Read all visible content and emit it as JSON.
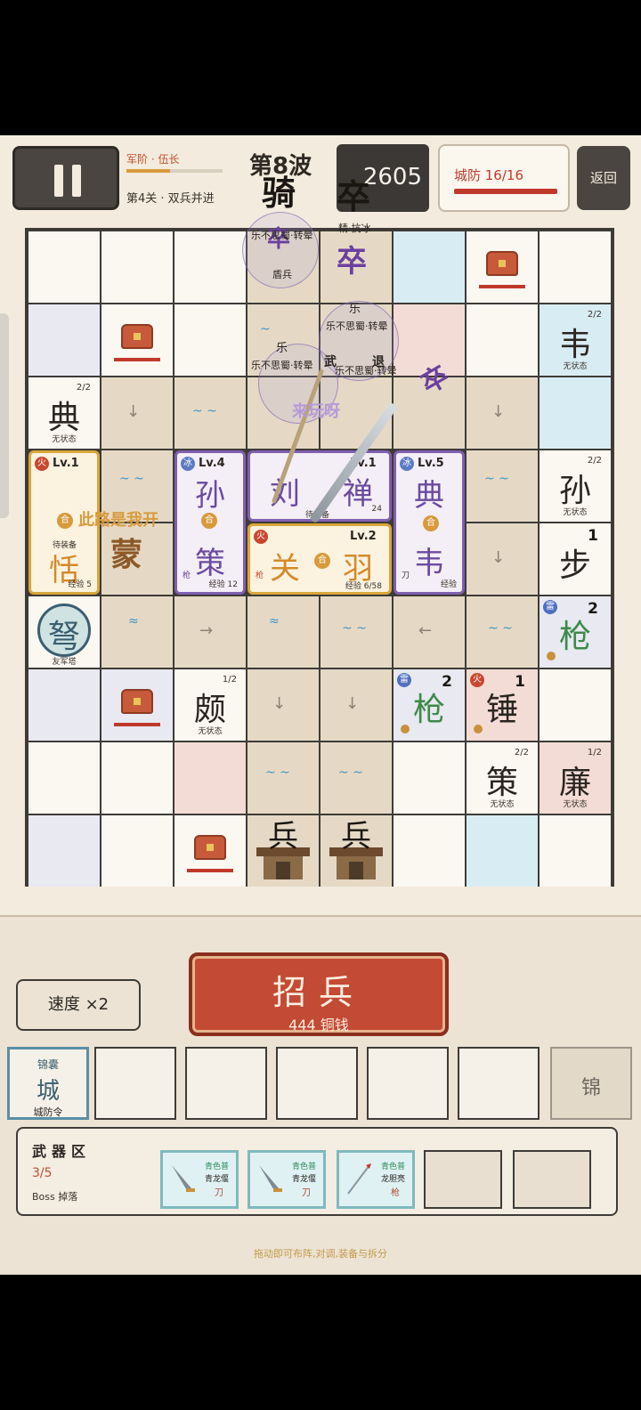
{
  "header": {
    "rank": "军阶 · 伍长",
    "rank_progress": 0.45,
    "level_name": "第4关 · 双兵并进",
    "wave": "第8波",
    "score": "2605",
    "city_defense": "城防 16/16",
    "return_label": "返回"
  },
  "board": {
    "enemies": [
      "骑",
      "卒",
      "卒",
      "卒",
      "卒"
    ],
    "status_texts": [
      "乐不思蜀·转晕",
      "乐不思蜀·转晕",
      "乐不思蜀·转晕",
      "乐不思蜀·转晕",
      "精·抗冰",
      "盾兵",
      "乐",
      "乐",
      "武",
      "退"
    ],
    "speech_1": "此路是我开",
    "speech_2": "来玩呀",
    "merge_symbol": "合",
    "tower_glyph": "蒙",
    "crossbow": {
      "glyph": "弩",
      "label": "友军塔"
    },
    "heroes": [
      {
        "element": "火",
        "level": "Lv.1",
        "name": "恬",
        "equip": "待装备",
        "xp": "经验 5"
      },
      {
        "element": "冰",
        "level": "Lv.4",
        "name_top": "孙",
        "name_bottom": "策",
        "weapon": "枪",
        "xp": "经验 12"
      },
      {
        "element": "",
        "level": "Lv.1",
        "name_left": "刘",
        "name_right": "禅",
        "equip": "待装备",
        "xp": "24"
      },
      {
        "element": "火",
        "level": "Lv.2",
        "name_left": "关",
        "name_right": "羽",
        "weapon": "枪",
        "xp": "经验 6/58"
      },
      {
        "element": "冰",
        "level": "Lv.5",
        "name_top": "典",
        "name_bottom": "韦",
        "weapon": "刀",
        "xp": "经验"
      }
    ],
    "units": [
      {
        "glyph": "韦",
        "count": "2/2",
        "status": "无状态"
      },
      {
        "glyph": "典",
        "count": "2/2",
        "status": "无状态"
      },
      {
        "glyph": "孙",
        "count": "2/2",
        "status": "无状态"
      },
      {
        "glyph": "步",
        "count": "1"
      },
      {
        "glyph": "枪",
        "count": "2",
        "element": "雷"
      },
      {
        "glyph": "颇",
        "count": "1/2",
        "status": "无状态"
      },
      {
        "glyph": "枪",
        "count": "2",
        "element": "雷"
      },
      {
        "glyph": "锤",
        "count": "1",
        "element": "火"
      },
      {
        "glyph": "策",
        "count": "2/2",
        "status": "无状态"
      },
      {
        "glyph": "廉",
        "count": "1/2",
        "status": "无状态"
      }
    ],
    "gate_glyph": "兵"
  },
  "controls": {
    "speed": "速度 ×2",
    "recruit_title": "招兵",
    "recruit_price": "444 铜钱"
  },
  "slots": [
    {
      "top": "锦囊",
      "glyph": "城",
      "label": "城防令"
    },
    {},
    {},
    {},
    {},
    {},
    {
      "locked": "锦"
    }
  ],
  "weapons": {
    "title": "武器区",
    "count": "3/5",
    "source": "Boss 掉落",
    "items": [
      {
        "rarity": "青色普",
        "name": "青龙偃",
        "kind": "刀"
      },
      {
        "rarity": "青色普",
        "name": "青龙偃",
        "kind": "刀"
      },
      {
        "rarity": "青色普",
        "name": "龙胆亮",
        "kind": "枪"
      }
    ]
  },
  "hint": "拖动即可布阵,对调,装备与拆分"
}
